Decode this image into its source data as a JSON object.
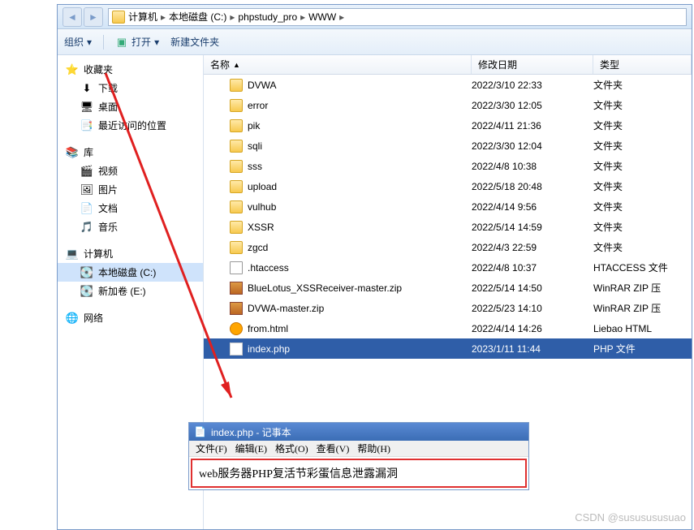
{
  "breadcrumb": [
    "计算机",
    "本地磁盘 (C:)",
    "phpstudy_pro",
    "WWW"
  ],
  "toolbar": {
    "organize": "组织",
    "open": "打开",
    "newfolder": "新建文件夹"
  },
  "columns": {
    "name": "名称",
    "date": "修改日期",
    "type": "类型"
  },
  "nav": {
    "favorites": {
      "label": "收藏夹",
      "items": [
        {
          "icon": "download",
          "label": "下载"
        },
        {
          "icon": "desktop",
          "label": "桌面"
        },
        {
          "icon": "recent",
          "label": "最近访问的位置"
        }
      ]
    },
    "libraries": {
      "label": "库",
      "items": [
        {
          "icon": "video",
          "label": "视频"
        },
        {
          "icon": "pictures",
          "label": "图片"
        },
        {
          "icon": "documents",
          "label": "文档"
        },
        {
          "icon": "music",
          "label": "音乐"
        }
      ]
    },
    "computer": {
      "label": "计算机",
      "items": [
        {
          "icon": "drive",
          "label": "本地磁盘 (C:)",
          "selected": true
        },
        {
          "icon": "drive",
          "label": "新加卷 (E:)"
        }
      ]
    },
    "network": {
      "label": "网络"
    }
  },
  "files": [
    {
      "icon": "folder",
      "name": "DVWA",
      "date": "2022/3/10 22:33",
      "type": "文件夹"
    },
    {
      "icon": "folder",
      "name": "error",
      "date": "2022/3/30 12:05",
      "type": "文件夹"
    },
    {
      "icon": "folder",
      "name": "pik",
      "date": "2022/4/11 21:36",
      "type": "文件夹"
    },
    {
      "icon": "folder",
      "name": "sqli",
      "date": "2022/3/30 12:04",
      "type": "文件夹"
    },
    {
      "icon": "folder",
      "name": "sss",
      "date": "2022/4/8 10:38",
      "type": "文件夹"
    },
    {
      "icon": "folder",
      "name": "upload",
      "date": "2022/5/18 20:48",
      "type": "文件夹"
    },
    {
      "icon": "folder",
      "name": "vulhub",
      "date": "2022/4/14 9:56",
      "type": "文件夹"
    },
    {
      "icon": "folder",
      "name": "XSSR",
      "date": "2022/5/14 14:59",
      "type": "文件夹"
    },
    {
      "icon": "folder",
      "name": "zgcd",
      "date": "2022/4/3 22:59",
      "type": "文件夹"
    },
    {
      "icon": "file",
      "name": ".htaccess",
      "date": "2022/4/8 10:37",
      "type": "HTACCESS 文件"
    },
    {
      "icon": "zip",
      "name": "BlueLotus_XSSReceiver-master.zip",
      "date": "2022/5/14 14:50",
      "type": "WinRAR ZIP 压"
    },
    {
      "icon": "zip",
      "name": "DVWA-master.zip",
      "date": "2022/5/23 14:10",
      "type": "WinRAR ZIP 压"
    },
    {
      "icon": "html",
      "name": "from.html",
      "date": "2022/4/14 14:26",
      "type": "Liebao HTML"
    },
    {
      "icon": "php",
      "name": "index.php",
      "date": "2023/1/11 11:44",
      "type": "PHP 文件",
      "selected": true
    }
  ],
  "notepad": {
    "title": "index.php - 记事本",
    "menu": [
      "文件(F)",
      "编辑(E)",
      "格式(O)",
      "查看(V)",
      "帮助(H)"
    ],
    "content": "web服务器PHP复活节彩蛋信息泄露漏洞"
  },
  "watermark": "CSDN @sususususuao"
}
